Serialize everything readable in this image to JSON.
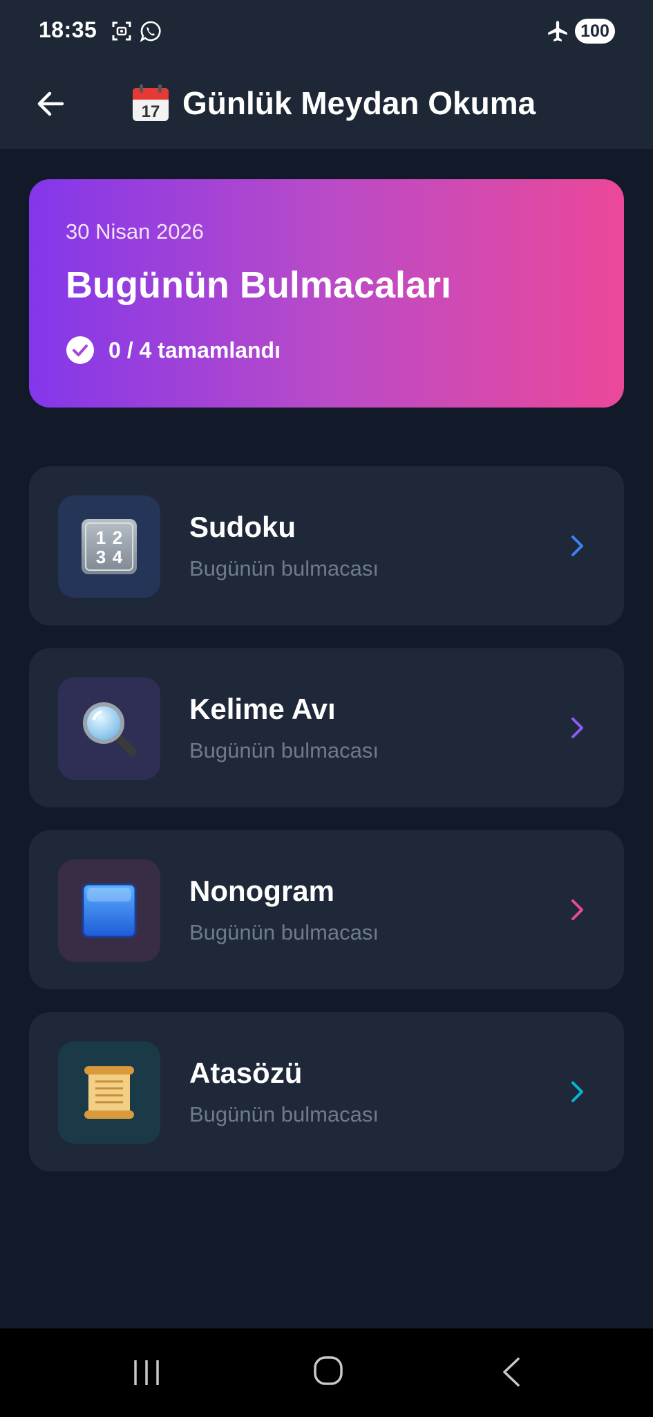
{
  "status_bar": {
    "time": "18:35",
    "battery": "100",
    "icons": [
      "screenshot-icon",
      "whatsapp-icon",
      "airplane-icon"
    ]
  },
  "app_bar": {
    "title": "Günlük Meydan Okuma",
    "back_icon": "arrow-left-icon",
    "title_icon": "calendar-icon"
  },
  "hero": {
    "date": "30 Nisan 2026",
    "title": "Bugünün Bulmacaları",
    "progress_text": "0 / 4 tamamlandı",
    "progress_icon": "check-circle-icon",
    "gradient": [
      "#8337ea",
      "#ec4899"
    ]
  },
  "games": [
    {
      "title": "Sudoku",
      "subtitle": "Bugünün bulmacası",
      "icon": "number-keycap-icon",
      "accent": "#3b82f6",
      "icon_bg": "#253558"
    },
    {
      "title": "Kelime Avı",
      "subtitle": "Bugünün bulmacası",
      "icon": "magnifier-icon",
      "accent": "#8b5cf6",
      "icon_bg": "#2f2f55"
    },
    {
      "title": "Nonogram",
      "subtitle": "Bugünün bulmacası",
      "icon": "blue-square-icon",
      "accent": "#ec4899",
      "icon_bg": "#392c45"
    },
    {
      "title": "Atasözü",
      "subtitle": "Bugünün bulmacası",
      "icon": "scroll-icon",
      "accent": "#06b6d4",
      "icon_bg": "#1b3a48"
    }
  ],
  "nav_bar": {
    "icons": [
      "recents-icon",
      "home-icon",
      "back-icon"
    ]
  }
}
